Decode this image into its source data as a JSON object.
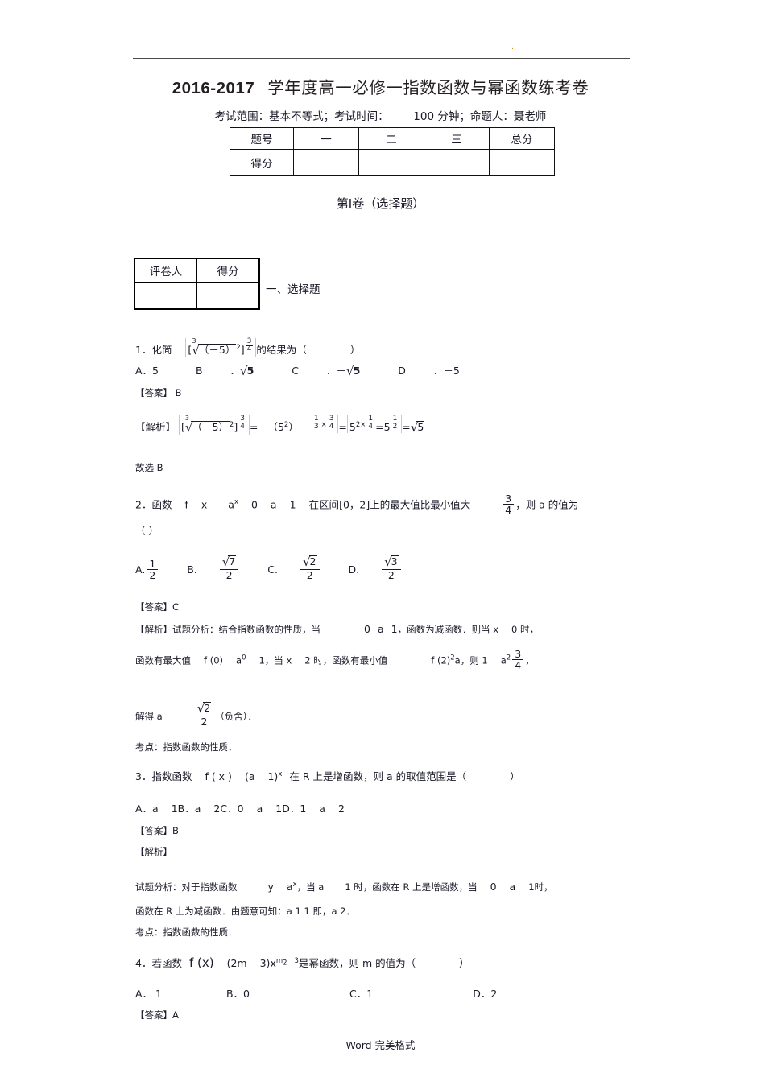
{
  "document": {
    "title_year": "2016-2017",
    "title_main": "学年度高一必修一指数函数与幂函数练考卷",
    "subtitle_a": "考试范围：基本不等式；考试时间：",
    "subtitle_b": "100 分钟；命题人：聂老师",
    "footer": "Word 完美格式"
  },
  "score_table": {
    "row1": [
      "题号",
      "一",
      "二",
      "三",
      "总分"
    ],
    "row2": [
      "得分",
      "",
      "",
      "",
      ""
    ]
  },
  "section": {
    "volume_heading": "第Ⅰ卷（选择题）",
    "choice_heading": "一、选择题"
  },
  "grader_table": {
    "row1": [
      "评卷人",
      "得分"
    ],
    "row2": [
      "",
      ""
    ]
  },
  "questions": [
    {
      "number": "1．化简",
      "stem_tail": "的结果为（",
      "stem_close": "）",
      "expr": {
        "bracket_open": "[",
        "root_index": "3",
        "radicand": "（－5）",
        "inner_exp": "2",
        "bracket_close": "]",
        "outer_n": "3",
        "outer_d": "4"
      },
      "options": [
        "A．5",
        "B",
        "．",
        "C",
        "．－",
        "D",
        "．－5"
      ],
      "opt_b_rad": "5",
      "opt_c_rad": "5",
      "answer_label": "【答案】",
      "answer_value": "B",
      "analysis_label": "【解析】",
      "solution": {
        "eq1_open": "[",
        "eq1_idx": "3",
        "eq1_rad": "（－5）",
        "eq1_inner": "2",
        "eq1_close": "]",
        "eq1_n": "3",
        "eq1_d": "4",
        "eq_sign1": "=",
        "term2": "（5",
        "term2_sup": "2",
        "term2_close": "）",
        "e2_n1": "1",
        "e2_d1": "3",
        "times": "×",
        "e2_n2": "3",
        "e2_d2": "4",
        "eq_sign2": "=",
        "term3": "5",
        "e3_a": "2×",
        "e3_n": "1",
        "e3_d": "4",
        "eq_sign3": "=",
        "term4": "5",
        "e4_n": "1",
        "e4_d": "2",
        "eq_sign4": "=",
        "term5_rad": "5"
      },
      "conclusion": "故选 B"
    },
    {
      "number": "2．函数",
      "line1_a": "f",
      "line1_b": "x",
      "line1_c": "a",
      "line1_c_sup": "x",
      "line1_d": "0",
      "line1_e": "a",
      "line1_f": "1",
      "line1_g": "在区间",
      "line1_h": "[0，2]",
      "line1_i": "上的最大值比最小值大",
      "line1_frac_n": "3",
      "line1_frac_d": "4",
      "line1_j": "，则 a 的值为",
      "line2": "（    ）",
      "options_labels": [
        "A.",
        "B.",
        "C.",
        "D."
      ],
      "optA_n": "1",
      "optA_d": "2",
      "optB_rad": "7",
      "optB_d": "2",
      "optC_rad": "2",
      "optC_d": "2",
      "optD_rad": "3",
      "optD_d": "2",
      "answer_label": "【答案】",
      "answer_value": "C",
      "analysis_label": "【解析】",
      "sol_line1": "试题分析：结合指数函数的性质，当",
      "sol_line1_b": "0",
      "sol_line1_c": "a",
      "sol_line1_d": "1",
      "sol_line1_e": "，函数为减函数．则当 x",
      "sol_line1_f": "0 时，",
      "sol_line2_a": "函数有最大值",
      "sol_line2_b": "f (0)",
      "sol_line2_c": "a",
      "sol_line2_c_sup": "0",
      "sol_line2_d": "1，当 x",
      "sol_line2_e": "2 时，函数有最小值",
      "sol_line2_f": "f (2)",
      "sol_line2_f_sup": "2",
      "sol_line2_g": "a，则 1",
      "sol_line2_h": "a",
      "sol_line2_h_sup": "2",
      "sol_line2_n": "3",
      "sol_line2_d2": "4",
      "sol_line2_comma": "，",
      "sol_line3_a": "解得 a",
      "sol_line3_rad": "2",
      "sol_line3_d": "2",
      "sol_line3_b": "（负舍）．",
      "kaodian": "考点：指数函数的性质．"
    },
    {
      "number": "3．指数函数",
      "stem_a": "f ( x )",
      "stem_b": "(a",
      "stem_c": "1)",
      "stem_c_sup": "x",
      "stem_d": "在 R 上是增函数，则 a 的取值范围是（",
      "stem_close": "）",
      "options_line": [
        "A．a",
        "1",
        "B．a",
        "2",
        "C．0",
        "a",
        "1",
        "D．1",
        "a",
        "2"
      ],
      "answer_label": "【答案】",
      "answer_value": "B",
      "analysis_label": "【解析】",
      "sol_line1_a": "试题分析：对于指数函数",
      "sol_line1_b": "y",
      "sol_line1_c": "a",
      "sol_line1_c_sup": "x",
      "sol_line1_d": "，当 a",
      "sol_line1_e": "1 时，函数在 R 上是增函数，当",
      "sol_line1_f": "0",
      "sol_line1_g": "a",
      "sol_line1_h": "1时，",
      "sol_line2": "函数在 R 上为减函数．由题意可知：a 1    1 即，a 2．",
      "kaodian": "考点：指数函数的性质．"
    },
    {
      "number": "4．若函数",
      "stem_a": "f (x)",
      "stem_b": "(2m",
      "stem_c": "3)x",
      "stem_sup_m": "m",
      "stem_sup_m_sub": "2",
      "stem_sup_3": "3",
      "stem_d": "是幂函数，则 m 的值为（",
      "stem_close": "）",
      "options": [
        "A． 1",
        "B．0",
        "C．1",
        "D．2"
      ],
      "answer_label": "【答案】",
      "answer_value": "A"
    }
  ]
}
